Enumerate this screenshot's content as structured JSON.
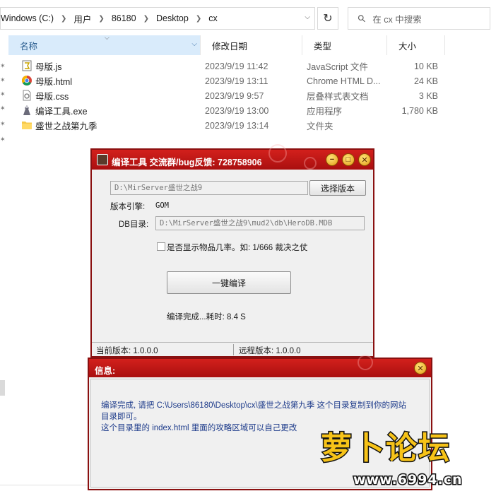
{
  "explorer": {
    "breadcrumbs": [
      "Windows (C:)",
      "用户",
      "86180",
      "Desktop",
      "cx"
    ],
    "search_placeholder": "在 cx 中搜索",
    "columns": [
      "名称",
      "修改日期",
      "类型",
      "大小"
    ],
    "files": [
      {
        "name": "母版.js",
        "date": "2023/9/19 11:42",
        "type": "JavaScript 文件",
        "size": "10 KB",
        "icon": "js-file-icon"
      },
      {
        "name": "母版.html",
        "date": "2023/9/19 13:11",
        "type": "Chrome HTML D...",
        "size": "24 KB",
        "icon": "chrome-icon"
      },
      {
        "name": "母版.css",
        "date": "2023/9/19 9:57",
        "type": "层叠样式表文档",
        "size": "3 KB",
        "icon": "css-file-icon"
      },
      {
        "name": "编译工具.exe",
        "date": "2023/9/19 13:00",
        "type": "应用程序",
        "size": "1,780 KB",
        "icon": "exe-icon"
      },
      {
        "name": "盛世之战第九季",
        "date": "2023/9/19 13:14",
        "type": "文件夹",
        "size": "",
        "icon": "folder-icon"
      }
    ]
  },
  "app": {
    "title": "编译工具 交流群/bug反馈: 728758906",
    "version_path": "D:\\MirServer盛世之战9",
    "select_button": "选择版本",
    "engine_label": "版本引擎:",
    "engine_value": "GOM",
    "db_label": "DB目录:",
    "db_path": "D:\\MirServer盛世之战9\\mud2\\db\\HeroDB.MDB",
    "checkbox_label": "是否显示物品几率。如: 1/666 裁决之仗",
    "compile_button": "一键编译",
    "result": "编译完成...耗时: 8.4 S",
    "current_version": "当前版本: 1.0.0.0",
    "remote_version": "远程版本: 1.0.0.0"
  },
  "info": {
    "title": "信息:",
    "line1": "编译完成, 请把 C:\\Users\\86180\\Desktop\\cx\\盛世之战第九季 这个目录复制到你的网站",
    "line2": "目录即可。",
    "line3": "这个目录里的 index.html 里面的攻略区域可以自己更改"
  },
  "watermark": {
    "brand": "萝卜论坛",
    "url": "www.6994.cn"
  },
  "colors": {
    "title_red": "#c0181a",
    "info_text": "#1c3a8a",
    "watermark_yellow": "#f7c318",
    "header_selected": "#d9ebfb"
  }
}
